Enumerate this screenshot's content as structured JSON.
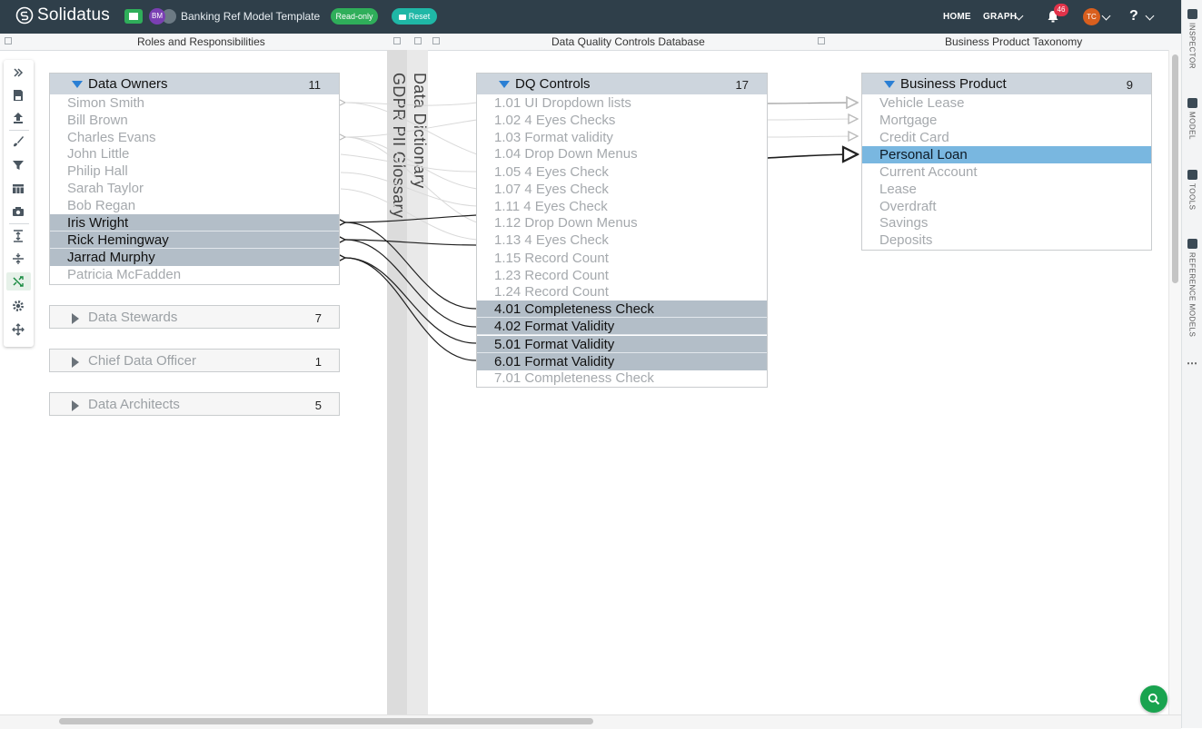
{
  "app": {
    "brand": "Solidatus",
    "model_title": "Banking Ref Model Template",
    "readonly_label": "Read-only",
    "reset_label": "Reset",
    "owner_initials": "BM"
  },
  "nav": {
    "home": "HOME",
    "graph": "GRAPH",
    "notifications": "46",
    "user_initials": "TC",
    "help": "?"
  },
  "layers": [
    {
      "title": "Roles and Responsibilities"
    },
    {
      "title": "Data Quality Controls Database"
    },
    {
      "title": "Business Product Taxonomy"
    }
  ],
  "collapsed_layers": [
    "Data Dictionary",
    "GDPR PII Glossary"
  ],
  "right_panel": [
    "INSPECTOR",
    "MODEL",
    "TOOLS",
    "REFERENCE MODELS"
  ],
  "data_owners": {
    "title": "Data Owners",
    "count": "11",
    "items": [
      {
        "label": "Simon Smith"
      },
      {
        "label": "Bill Brown"
      },
      {
        "label": "Charles Evans"
      },
      {
        "label": "John Little"
      },
      {
        "label": "Philip Hall"
      },
      {
        "label": "Sarah Taylor"
      },
      {
        "label": "Bob Regan"
      },
      {
        "label": "Iris Wright"
      },
      {
        "label": "Rick Hemingway"
      },
      {
        "label": "Jarrad Murphy"
      },
      {
        "label": "Patricia McFadden"
      }
    ]
  },
  "collapsed_groups": [
    {
      "title": "Data Stewards",
      "count": "7"
    },
    {
      "title": "Chief Data Officer",
      "count": "1"
    },
    {
      "title": "Data Architects",
      "count": "5"
    }
  ],
  "dq_controls": {
    "title": "DQ Controls",
    "count": "17",
    "items": [
      {
        "label": "1.01 UI Dropdown lists"
      },
      {
        "label": "1.02 4 Eyes Checks"
      },
      {
        "label": "1.03 Format validity"
      },
      {
        "label": "1.04 Drop Down Menus"
      },
      {
        "label": "1.05 4 Eyes Check"
      },
      {
        "label": "1.07 4 Eyes Check"
      },
      {
        "label": "1.11 4 Eyes Check"
      },
      {
        "label": "1.12 Drop Down Menus"
      },
      {
        "label": "1.13 4 Eyes Check"
      },
      {
        "label": "1.15 Record Count"
      },
      {
        "label": "1.23 Record Count"
      },
      {
        "label": "1.24 Record Count"
      },
      {
        "label": "4.01 Completeness Check"
      },
      {
        "label": "4.02 Format Validity"
      },
      {
        "label": "5.01 Format Validity"
      },
      {
        "label": "6.01 Format Validity"
      },
      {
        "label": "7.01 Completeness Check"
      }
    ]
  },
  "business_product": {
    "title": "Business Product",
    "count": "9",
    "items": [
      {
        "label": "Vehicle Lease"
      },
      {
        "label": "Mortgage"
      },
      {
        "label": "Credit Card"
      },
      {
        "label": "Personal Loan"
      },
      {
        "label": "Current Account"
      },
      {
        "label": "Lease"
      },
      {
        "label": "Overdraft"
      },
      {
        "label": "Savings"
      },
      {
        "label": "Deposits"
      }
    ]
  },
  "colors": {
    "topbar": "#2f3f4a",
    "accent_green": "#2fae5a",
    "selected_row": "#b3bec8",
    "highlight_row": "#79b7e0"
  }
}
